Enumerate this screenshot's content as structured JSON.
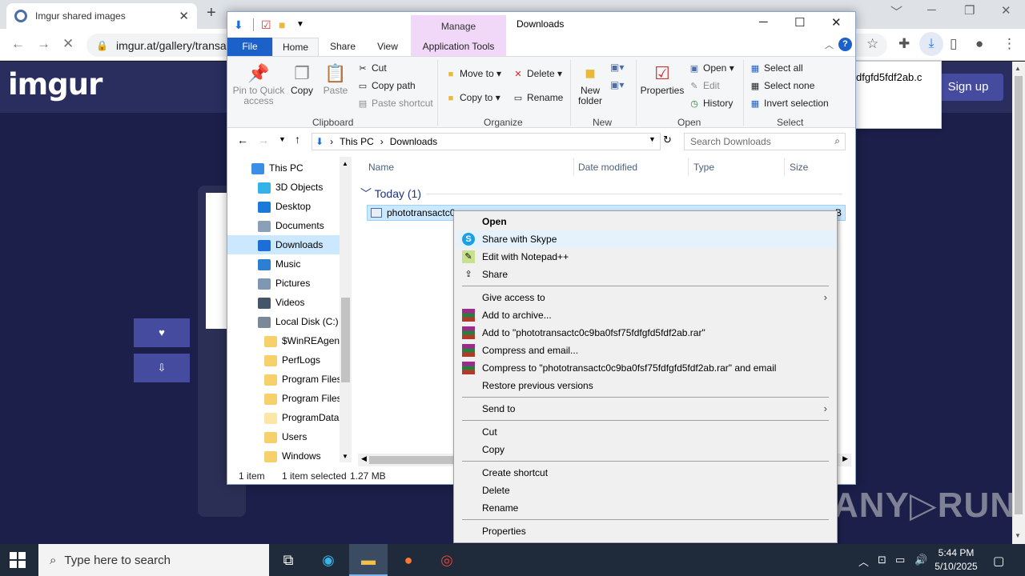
{
  "browser": {
    "tab_title": "Imgur shared images",
    "tab_close": "✕",
    "new_tab": "+",
    "url": "imgur.at/gallery/transa",
    "win_minimize": "─",
    "win_restore": "❐",
    "win_close": "✕",
    "tab_search": "﹀"
  },
  "imgur": {
    "logo": "imgur",
    "signup": "Sign up",
    "download_popup_text": "dfgfd5fdf2ab.c",
    "like_btn": "♥",
    "download_btn": "⇩",
    "watermark": "ANY▷RUN"
  },
  "explorer": {
    "title": "Downloads",
    "manage_tab": "Manage",
    "tabs": {
      "file": "File",
      "home": "Home",
      "share": "Share",
      "view": "View",
      "app_tools": "Application Tools"
    },
    "ribbon": {
      "clipboard": {
        "label": "Clipboard",
        "pin": "Pin to Quick access",
        "copy": "Copy",
        "paste": "Paste",
        "cut": "Cut",
        "copy_path": "Copy path",
        "paste_shortcut": "Paste shortcut"
      },
      "organize": {
        "label": "Organize",
        "move_to": "Move to",
        "copy_to": "Copy to",
        "delete": "Delete",
        "rename": "Rename"
      },
      "new": {
        "label": "New",
        "new_folder": "New folder"
      },
      "open": {
        "label": "Open",
        "properties": "Properties",
        "open": "Open",
        "edit": "Edit",
        "history": "History"
      },
      "select": {
        "label": "Select",
        "select_all": "Select all",
        "select_none": "Select none",
        "invert": "Invert selection"
      }
    },
    "address": {
      "this_pc": "This PC",
      "downloads": "Downloads",
      "search_placeholder": "Search Downloads"
    },
    "nav": [
      {
        "label": "This PC",
        "icon": "computer-icon",
        "color": "#3a8ee6"
      },
      {
        "label": "3D Objects",
        "icon": "3d-objects-icon",
        "color": "#36b3e6"
      },
      {
        "label": "Desktop",
        "icon": "desktop-icon",
        "color": "#1a7ad9"
      },
      {
        "label": "Documents",
        "icon": "documents-icon",
        "color": "#8aa0b8"
      },
      {
        "label": "Downloads",
        "icon": "downloads-icon",
        "color": "#1c6fd6"
      },
      {
        "label": "Music",
        "icon": "music-icon",
        "color": "#2d7fd3"
      },
      {
        "label": "Pictures",
        "icon": "pictures-icon",
        "color": "#7f97b3"
      },
      {
        "label": "Videos",
        "icon": "videos-icon",
        "color": "#44566a"
      },
      {
        "label": "Local Disk (C:)",
        "icon": "disk-icon",
        "color": "#7a8899"
      },
      {
        "label": "$WinREAgent",
        "icon": "folder-icon",
        "color": "#f5d06b"
      },
      {
        "label": "PerfLogs",
        "icon": "folder-icon",
        "color": "#f5d06b"
      },
      {
        "label": "Program Files",
        "icon": "folder-icon",
        "color": "#f5d06b"
      },
      {
        "label": "Program Files (x86)",
        "icon": "folder-icon",
        "color": "#f5d06b"
      },
      {
        "label": "ProgramData",
        "icon": "folder-icon",
        "color": "#fbe6a8"
      },
      {
        "label": "Users",
        "icon": "folder-icon",
        "color": "#f5d06b"
      },
      {
        "label": "Windows",
        "icon": "folder-icon",
        "color": "#f5d06b"
      }
    ],
    "columns": {
      "name": "Name",
      "date": "Date modified",
      "type": "Type",
      "size": "Size"
    },
    "group": "Today (1)",
    "file_name": "phototransactc0",
    "file_size_tail": "B",
    "status": {
      "count": "1 item",
      "selected": "1 item selected",
      "size": "1.27 MB"
    }
  },
  "context_menu": {
    "items": [
      {
        "label": "Open",
        "bold": true
      },
      {
        "label": "Share with Skype",
        "icon": "skype-icon",
        "highlighted": true
      },
      {
        "label": "Edit with Notepad++",
        "icon": "notepad-plus-plus-icon"
      },
      {
        "label": "Share",
        "icon": "share-icon"
      },
      {
        "label": "Give access to",
        "submenu": true
      },
      {
        "label": "Add to archive...",
        "icon": "winrar-icon"
      },
      {
        "label": "Add to \"phototransactc0c9ba0fsf75fdfgfd5fdf2ab.rar\"",
        "icon": "winrar-icon"
      },
      {
        "label": "Compress and email...",
        "icon": "winrar-icon"
      },
      {
        "label": "Compress to \"phototransactc0c9ba0fsf75fdfgfd5fdf2ab.rar\" and email",
        "icon": "winrar-icon"
      },
      {
        "label": "Restore previous versions"
      },
      {
        "label": "Send to",
        "submenu": true
      },
      {
        "label": "Cut"
      },
      {
        "label": "Copy"
      },
      {
        "label": "Create shortcut"
      },
      {
        "label": "Delete"
      },
      {
        "label": "Rename"
      },
      {
        "label": "Properties"
      }
    ]
  },
  "taskbar": {
    "search_placeholder": "Type here to search",
    "time": "5:44 PM",
    "date": "5/10/2025"
  }
}
